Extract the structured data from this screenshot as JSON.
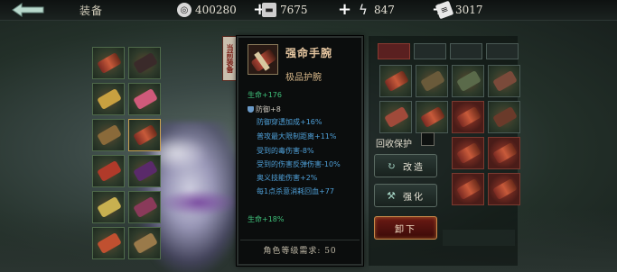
{
  "header": {
    "back_icon": "back-arrow-icon",
    "title": "装备",
    "resources": [
      {
        "icon": "coin-icon",
        "value": "400280"
      },
      {
        "icon": "ingot-icon",
        "value": "7675"
      },
      {
        "icon": "lightning-icon",
        "value": "847"
      },
      {
        "icon": "ticket-icon",
        "value": "3017"
      }
    ],
    "plus_label": "+"
  },
  "item": {
    "equipped_tag": "当前装备",
    "name": "强命手腕",
    "quality": "极品护腕",
    "stats": [
      {
        "text": "生命+176",
        "color": "green"
      },
      {
        "text": "防御+8",
        "color": "white",
        "icon": "shield-icon"
      },
      {
        "text": "防御穿透加成+16%",
        "color": "blue"
      },
      {
        "text": "普攻最大限制距离+11%",
        "color": "blue"
      },
      {
        "text": "受到的毒伤害-8%",
        "color": "blue"
      },
      {
        "text": "受到的伤害反弹伤害-10%",
        "color": "blue"
      },
      {
        "text": "奥义技能伤害+2%",
        "color": "blue"
      },
      {
        "text": "每1点杀意消耗回血+77",
        "color": "blue"
      },
      {
        "text": "生命+18%",
        "color": "green"
      }
    ],
    "level_requirement": "角色等级需求: 50"
  },
  "actions": {
    "recycle_protect_label": "回收保护",
    "reforge_label": "改造",
    "enhance_label": "强化",
    "unequip_label": "卸下"
  },
  "colors": {
    "green_stat": "#3fc07a",
    "blue_stat": "#4fa0d8",
    "unequip_button": "#6a1a14"
  }
}
